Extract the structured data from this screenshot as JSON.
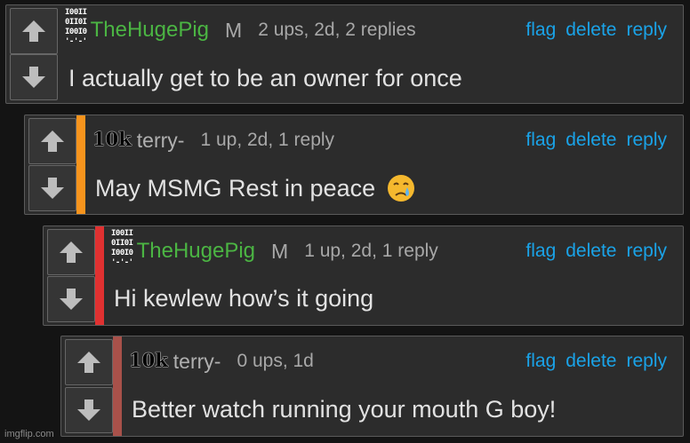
{
  "colors": {
    "background": "#141414",
    "panel": "#2c2c2c",
    "username_green": "#4bb543",
    "link_blue": "#1aa3e8",
    "depth_orange": "#f7941d",
    "depth_red": "#e03131",
    "depth_brown": "#a8514a"
  },
  "icons": {
    "upvote": "up-arrow-icon",
    "downvote": "down-arrow-icon",
    "emoji": "crying-face-emoji"
  },
  "comments": [
    {
      "badge": "binary",
      "badge_lines": [
        "I00II",
        "0II0I",
        "I00I0",
        "'-'-'"
      ],
      "username": "TheHugePig",
      "gender": "M",
      "meta": "2 ups, 2d, 2 replies",
      "actions": {
        "flag": "flag",
        "delete": "delete",
        "reply": "reply"
      },
      "text": "I actually get to be an owner for once"
    },
    {
      "badge": "10k",
      "username": "terry-",
      "gender": "",
      "meta": "1 up, 2d, 1 reply",
      "actions": {
        "flag": "flag",
        "delete": "delete",
        "reply": "reply"
      },
      "text": "May MSMG Rest in peace"
    },
    {
      "badge": "binary",
      "badge_lines": [
        "I00II",
        "0II0I",
        "I00I0",
        "'-'-'"
      ],
      "username": "TheHugePig",
      "gender": "M",
      "meta": "1 up, 2d, 1 reply",
      "actions": {
        "flag": "flag",
        "delete": "delete",
        "reply": "reply"
      },
      "text": "Hi kewlew how’s it going"
    },
    {
      "badge": "10k",
      "username": "terry-",
      "gender": "",
      "meta": "0 ups, 1d",
      "actions": {
        "flag": "flag",
        "delete": "delete",
        "reply": "reply"
      },
      "text": "Better watch running your mouth G boy!"
    }
  ],
  "watermark": "imgflip.com"
}
